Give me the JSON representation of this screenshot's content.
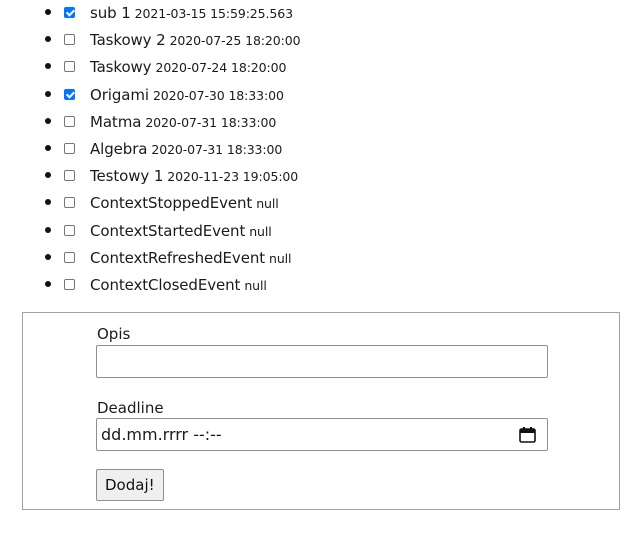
{
  "tasks": [
    {
      "name": "sub 1",
      "date": "2021-03-15 15:59:25.563",
      "checked": true
    },
    {
      "name": "Taskowy 2",
      "date": "2020-07-25 18:20:00",
      "checked": false
    },
    {
      "name": "Taskowy",
      "date": "2020-07-24 18:20:00",
      "checked": false
    },
    {
      "name": "Origami",
      "date": "2020-07-30 18:33:00",
      "checked": true
    },
    {
      "name": "Matma",
      "date": "2020-07-31 18:33:00",
      "checked": false
    },
    {
      "name": "Algebra",
      "date": "2020-07-31 18:33:00",
      "checked": false
    },
    {
      "name": "Testowy 1",
      "date": "2020-11-23 19:05:00",
      "checked": false
    },
    {
      "name": "ContextStoppedEvent",
      "date": "null",
      "checked": false
    },
    {
      "name": "ContextStartedEvent",
      "date": "null",
      "checked": false
    },
    {
      "name": "ContextRefreshedEvent",
      "date": "null",
      "checked": false
    },
    {
      "name": "ContextClosedEvent",
      "date": "null",
      "checked": false
    }
  ],
  "form": {
    "description_label": "Opis",
    "description_value": "",
    "deadline_label": "Deadline",
    "deadline_placeholder": "dd.mm.rrrr --:--",
    "submit_label": "Dodaj!"
  },
  "colors": {
    "checkbox_checked": "#0075ff",
    "border": "#a0a0a0"
  },
  "icons": {
    "deadline_picker": "calendar-icon"
  }
}
